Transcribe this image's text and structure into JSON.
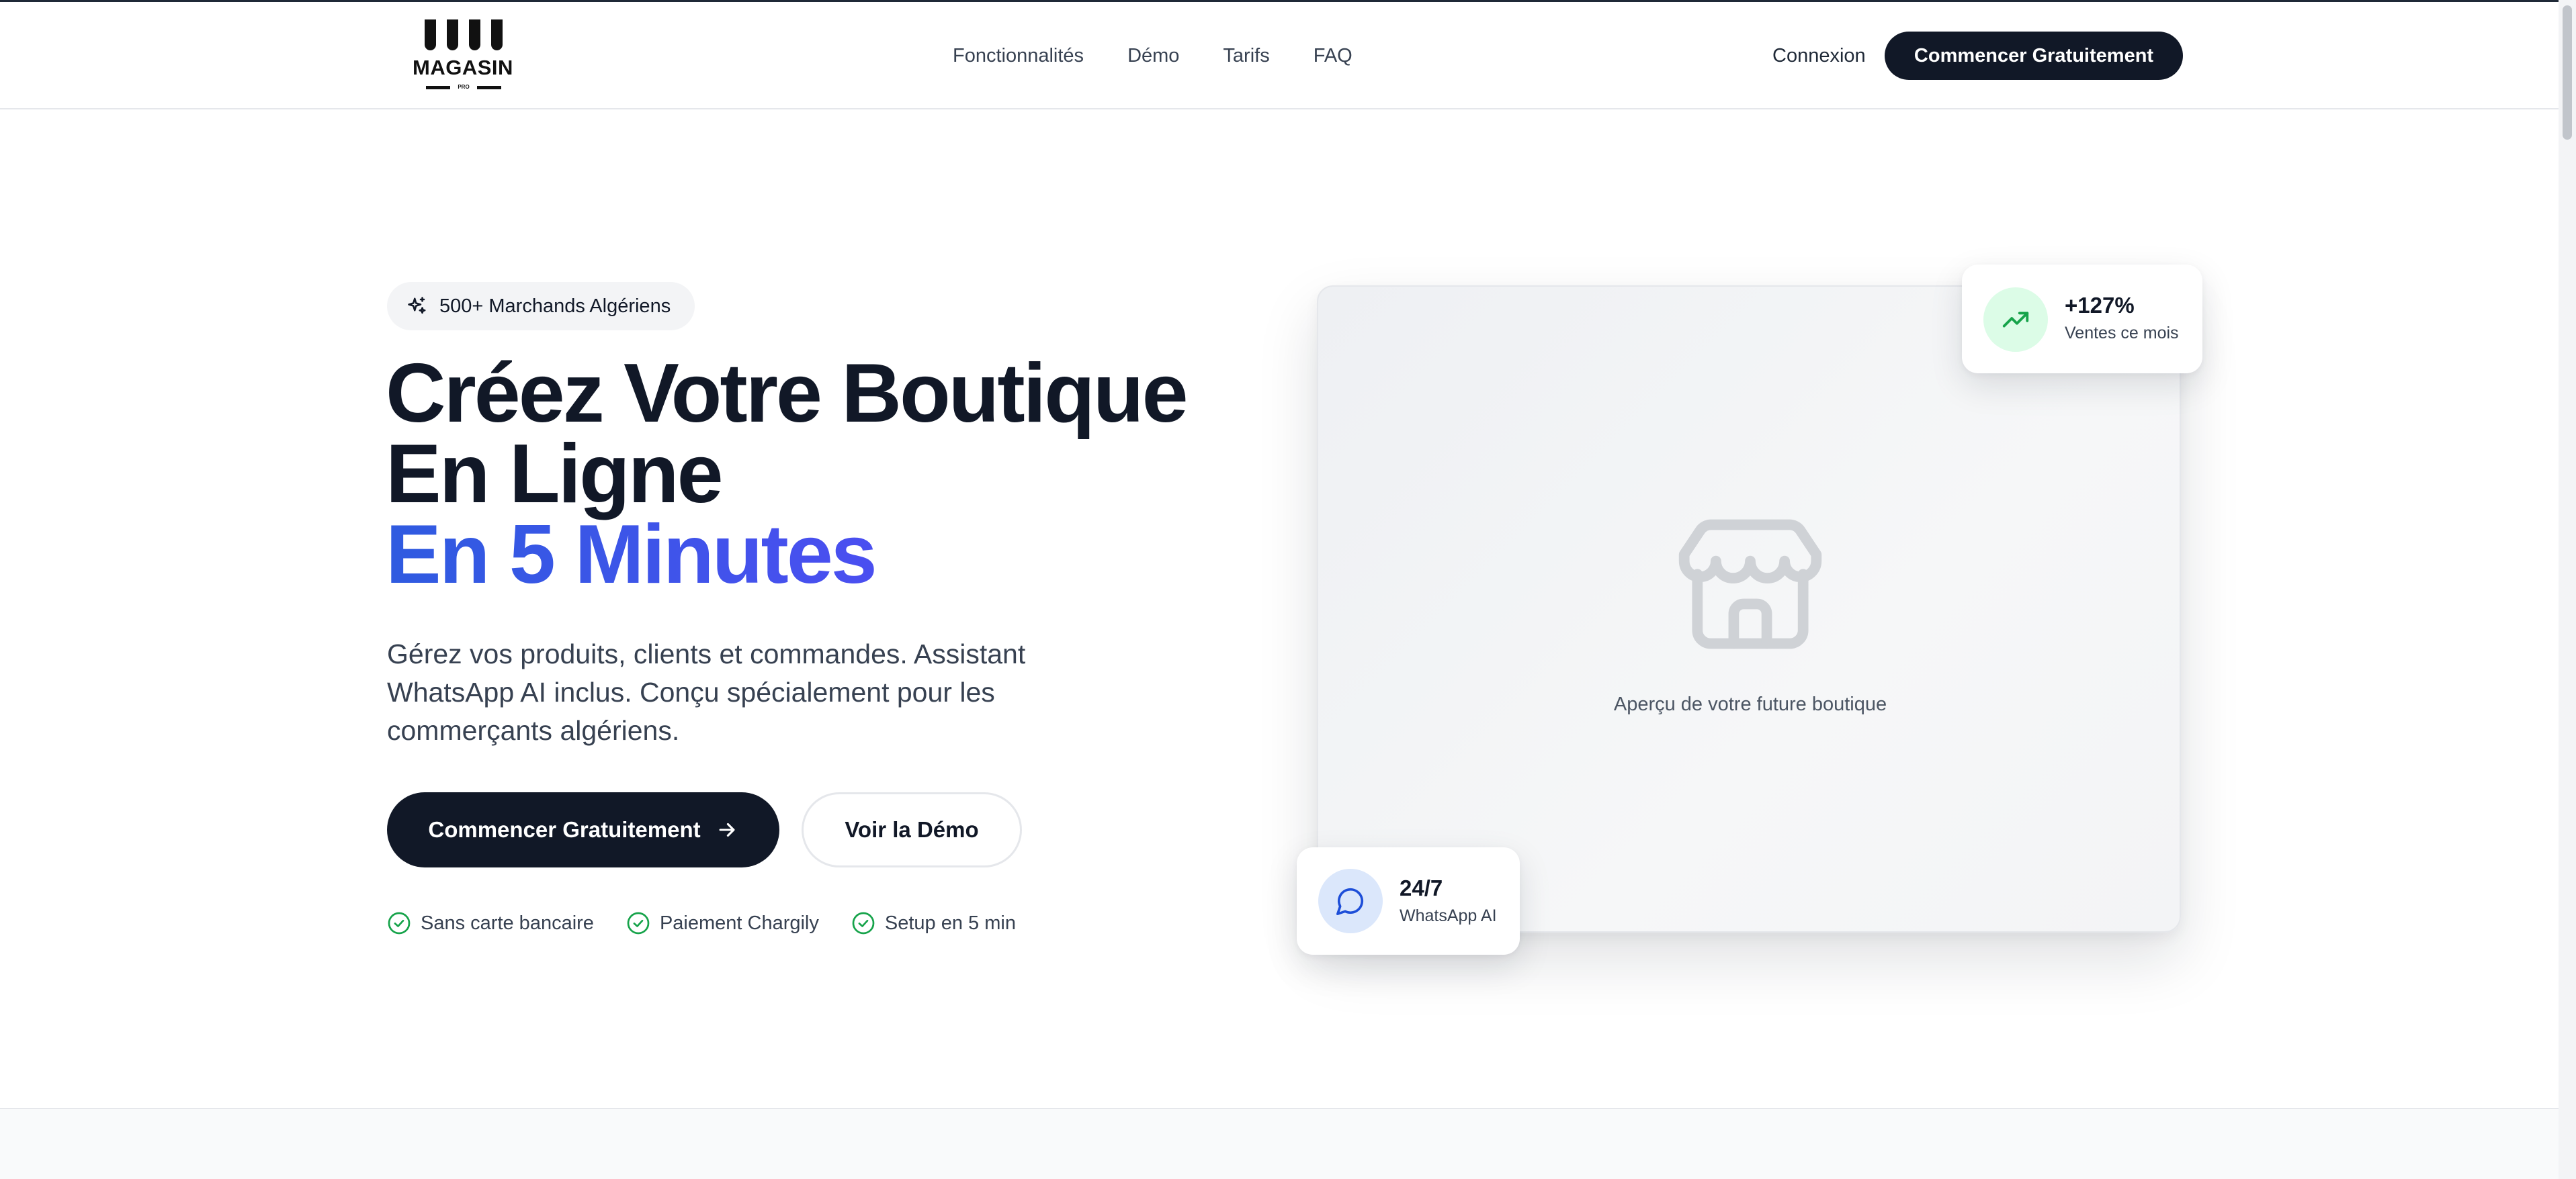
{
  "brand": {
    "logo_word": "MAGASIN",
    "logo_sub": "PRO"
  },
  "nav": {
    "links": [
      "Fonctionnalités",
      "Démo",
      "Tarifs",
      "FAQ"
    ],
    "login_label": "Connexion",
    "cta_label": "Commencer Gratuitement"
  },
  "hero": {
    "badge_icon": "sparkles-icon",
    "badge_text": "500+ Marchands Algériens",
    "title_line1": "Créez Votre Boutique",
    "title_line2": "En Ligne",
    "title_accent": "En 5 Minutes",
    "lead": "Gérez vos produits, clients et commandes. Assistant WhatsApp AI inclus. Conçu spécialement pour les commerçants algériens.",
    "primary_cta": "Commencer Gratuitement",
    "primary_cta_icon": "arrow-right-icon",
    "secondary_cta": "Voir la Démo",
    "checks": [
      "Sans carte bancaire",
      "Paiement Chargily",
      "Setup en 5 min"
    ],
    "check_icon": "check-circle-icon"
  },
  "preview": {
    "icon": "store-icon",
    "caption": "Aperçu de votre future boutique",
    "sales_card": {
      "icon": "trending-up-icon",
      "value": "+127%",
      "label": "Ventes ce mois"
    },
    "whatsapp_card": {
      "icon": "chat-bubble-icon",
      "value": "24/7",
      "label": "WhatsApp AI"
    }
  },
  "colors": {
    "primary_dark": "#111827",
    "accent_blue": "#2f5be0",
    "accent_violet": "#5c4de6",
    "success_green": "#16a34a",
    "chat_blue": "#1d4ed8"
  }
}
